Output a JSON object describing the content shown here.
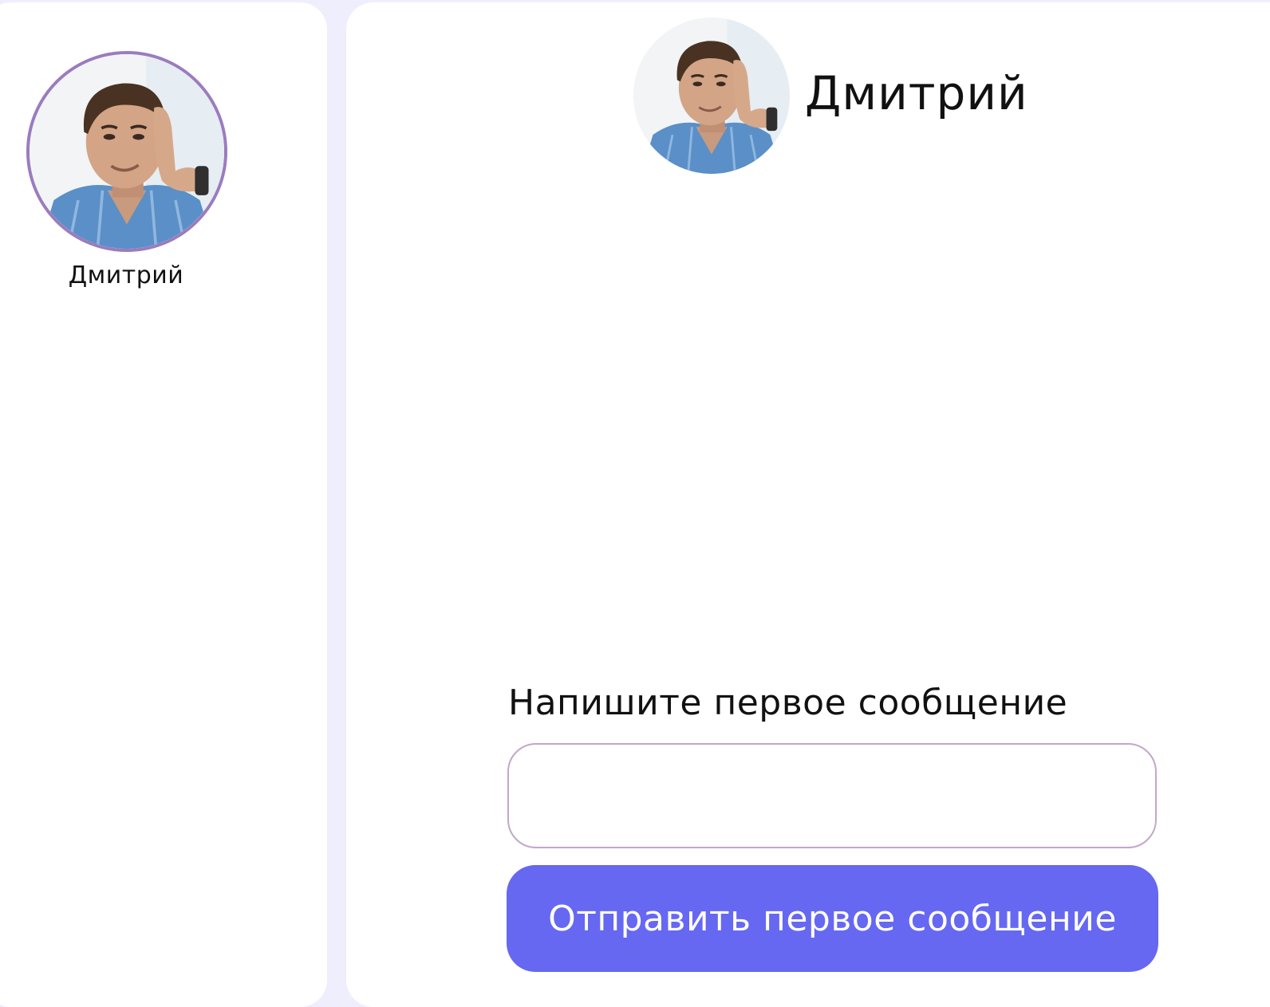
{
  "sidebar": {
    "contacts": [
      {
        "name": "Дмитрий",
        "avatar_icon": "person-photo",
        "selected": true
      }
    ]
  },
  "chat": {
    "header": {
      "name": "Дмитрий",
      "avatar_icon": "person-photo"
    },
    "empty_prompt": "Напишите первое сообщение",
    "input": {
      "value": "",
      "placeholder": ""
    },
    "send_label": "Отправить первое сообщение"
  },
  "colors": {
    "background": "#efeefd",
    "panel": "#ffffff",
    "accent": "#6668f2",
    "avatar_ring": "#9b7cbd",
    "input_border": "#c3a6c9"
  }
}
